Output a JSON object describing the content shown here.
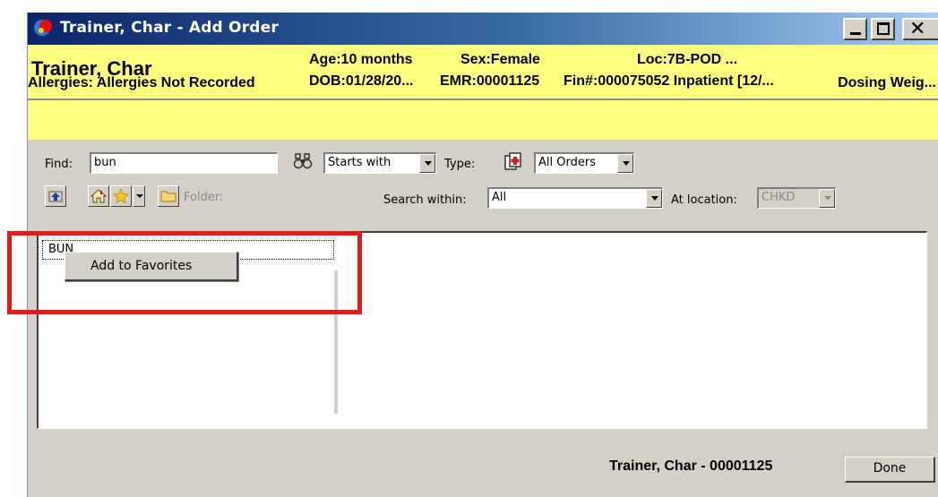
{
  "window": {
    "title": "Trainer, Char - Add Order",
    "icon": "app-logo-icon",
    "controls": {
      "minimize": "minimize-icon",
      "maximize": "maximize-icon",
      "close": "close-icon"
    }
  },
  "banner": {
    "patient_name": "Trainer, Char",
    "age": "Age:10 months",
    "sex": "Sex:Female",
    "loc": "Loc:7B-POD ...",
    "dob": "DOB:01/28/20...",
    "emr": "EMR:00001125",
    "fin": "Fin#:000075052 Inpatient [12/...",
    "allergies": "Allergies: Allergies Not Recorded",
    "dosing_weight": "Dosing Weig...",
    "background_color": "#ffff80"
  },
  "search": {
    "find_label": "Find:",
    "find_value": "bun",
    "match_mode": "Starts with",
    "type_label": "Type:",
    "type_value": "All Orders",
    "folder_label": "Folder:",
    "search_within_label": "Search within:",
    "search_within_value": "All",
    "at_location_label": "At location:",
    "at_location_value": "CHKD",
    "icons": [
      "binoculars-icon",
      "order-type-icon",
      "up-folder-icon",
      "home-icon",
      "favorites-star-icon",
      "folder-icon"
    ]
  },
  "results": {
    "items": [
      {
        "label": "BUN"
      }
    ]
  },
  "context_menu": {
    "items": [
      {
        "label": "Add to Favorites"
      }
    ]
  },
  "annotation": {
    "color": "#e31b1b"
  },
  "footer": {
    "patient_id": "Trainer, Char - 00001125",
    "done_label": "Done"
  }
}
